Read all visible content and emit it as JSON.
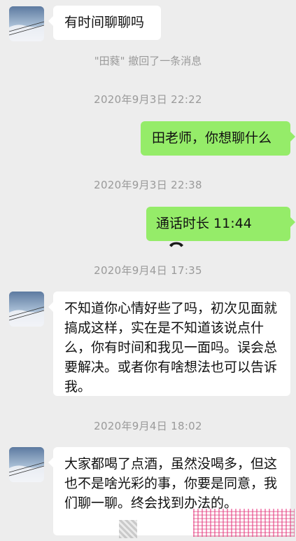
{
  "colors": {
    "background": "#ededed",
    "incoming_bubble": "#ffffff",
    "outgoing_bubble": "#95ec69",
    "meta_text": "#9a9a9a"
  },
  "messages": {
    "m1": {
      "text": "有时间聊聊吗"
    },
    "recall_notice": "\"田蕤\" 撤回了一条消息",
    "ts1": "2020年9月3日 22:22",
    "m2": {
      "text": "田老师，你想聊什么"
    },
    "ts2": "2020年9月3日 22:38",
    "call": {
      "text": "通话时长 11:44",
      "icon": "phone-hangup-icon"
    },
    "ts3": "2020年9月4日 17:35",
    "m3": {
      "text": "不知道你心情好些了吗，初次见面就搞成这样，实在是不知道该说点什么，你有时间和我见一面吗。误会总要解决。或者你有啥想法也可以告诉我。"
    },
    "ts4": "2020年9月4日 18:02",
    "m4": {
      "text": "大家都喝了点酒，虽然没喝多，但这也不是啥光彩的事，你要是同意，我们聊一聊。终会找到办法的。"
    }
  }
}
